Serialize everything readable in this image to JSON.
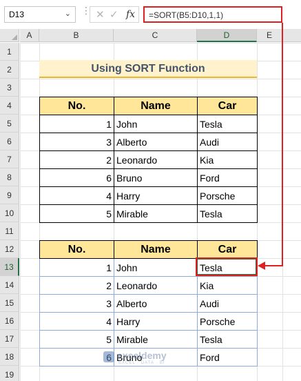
{
  "formula_bar": {
    "name_box": "D13",
    "formula": "=SORT(B5:D10,1,1)",
    "cancel_icon": "close-icon",
    "enter_icon": "checkmark-icon",
    "function_icon": "fx"
  },
  "columns": [
    "A",
    "B",
    "C",
    "D",
    "E"
  ],
  "rows": [
    "1",
    "2",
    "3",
    "4",
    "5",
    "6",
    "7",
    "8",
    "9",
    "10",
    "11",
    "12",
    "13",
    "14",
    "15",
    "16",
    "17",
    "18",
    "19"
  ],
  "title": "Using SORT Function",
  "table1": {
    "headers": [
      "No.",
      "Name",
      "Car"
    ],
    "rows": [
      {
        "no": "1",
        "name": "John",
        "car": "Tesla"
      },
      {
        "no": "3",
        "name": "Alberto",
        "car": "Audi"
      },
      {
        "no": "2",
        "name": "Leonardo",
        "car": "Kia"
      },
      {
        "no": "6",
        "name": "Bruno",
        "car": "Ford"
      },
      {
        "no": "4",
        "name": "Harry",
        "car": "Porsche"
      },
      {
        "no": "5",
        "name": "Mirable",
        "car": "Tesla"
      }
    ]
  },
  "table2": {
    "headers": [
      "No.",
      "Name",
      "Car"
    ],
    "rows": [
      {
        "no": "1",
        "name": "John",
        "car": "Tesla"
      },
      {
        "no": "2",
        "name": "Leonardo",
        "car": "Kia"
      },
      {
        "no": "3",
        "name": "Alberto",
        "car": "Audi"
      },
      {
        "no": "4",
        "name": "Harry",
        "car": "Porsche"
      },
      {
        "no": "5",
        "name": "Mirable",
        "car": "Tesla"
      },
      {
        "no": "6",
        "name": "Bruno",
        "car": "Ford"
      }
    ]
  },
  "watermark": {
    "name": "exceldemy",
    "tagline": "EXCEL · DATA · BI"
  },
  "colors": {
    "highlight_red": "#e02020",
    "header_fill": "#ffe699",
    "title_fill": "#fff2cc",
    "title_underline": "#f0b323",
    "title_text": "#44546a",
    "selection_green": "#217346"
  }
}
